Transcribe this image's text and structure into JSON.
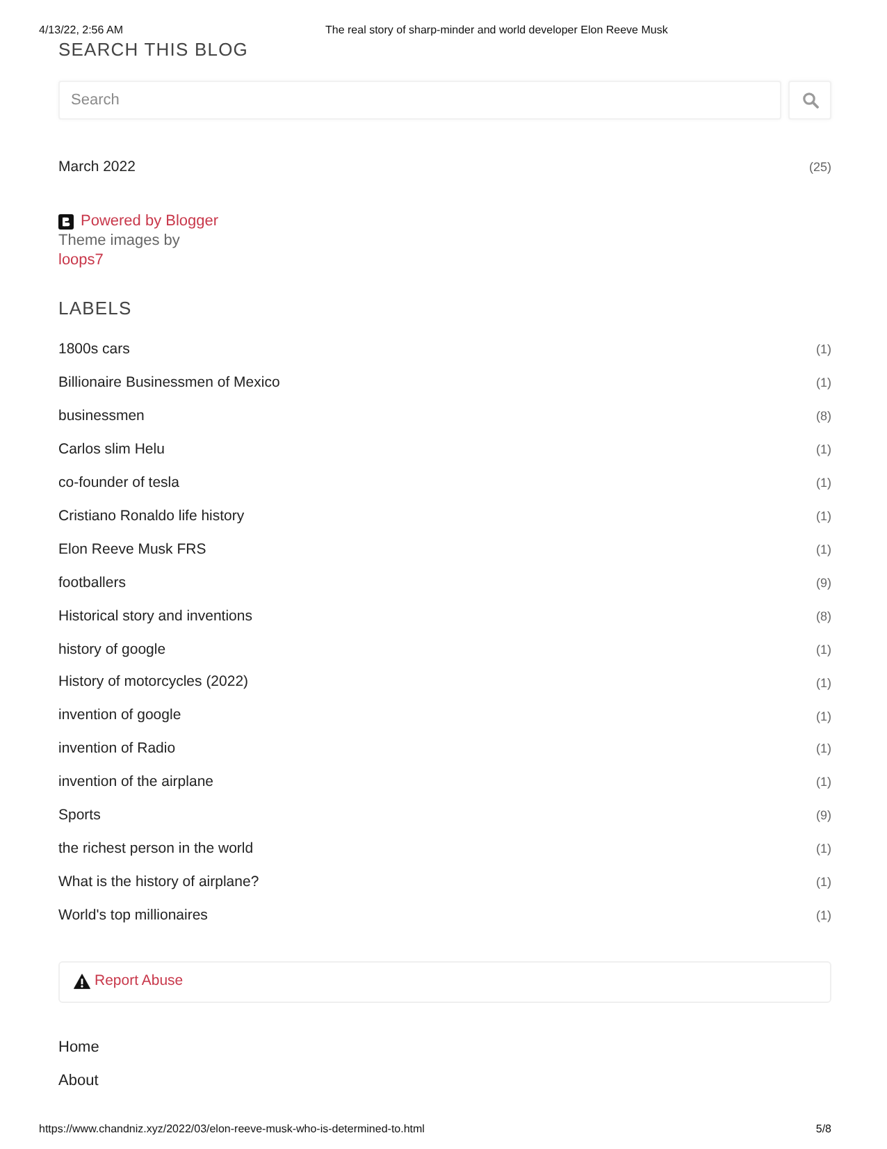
{
  "print_header": {
    "date": "4/13/22, 2:56 AM",
    "title": "The real story of sharp-minder and world developer Elon Reeve Musk"
  },
  "search_widget": {
    "heading": "SEARCH THIS BLOG",
    "placeholder": "Search"
  },
  "archive": [
    {
      "label": "March 2022",
      "count": "(25)"
    }
  ],
  "attribution": {
    "powered_by": "Powered by Blogger",
    "theme_text": "Theme images by",
    "theme_author": "loops7"
  },
  "labels": {
    "heading": "LABELS",
    "items": [
      {
        "label": "1800s cars",
        "count": "(1)"
      },
      {
        "label": "Billionaire Businessmen of Mexico",
        "count": "(1)"
      },
      {
        "label": "businessmen",
        "count": "(8)"
      },
      {
        "label": "Carlos slim Helu",
        "count": "(1)"
      },
      {
        "label": "co-founder of tesla",
        "count": "(1)"
      },
      {
        "label": "Cristiano Ronaldo life history",
        "count": "(1)"
      },
      {
        "label": "Elon Reeve Musk FRS",
        "count": "(1)"
      },
      {
        "label": "footballers",
        "count": "(9)"
      },
      {
        "label": "Historical story and inventions",
        "count": "(8)"
      },
      {
        "label": "history of google",
        "count": "(1)"
      },
      {
        "label": "History of motorcycles (2022)",
        "count": "(1)"
      },
      {
        "label": "invention of google",
        "count": "(1)"
      },
      {
        "label": "invention of Radio",
        "count": "(1)"
      },
      {
        "label": "invention of the airplane",
        "count": "(1)"
      },
      {
        "label": "Sports",
        "count": "(9)"
      },
      {
        "label": "the richest person in the world",
        "count": "(1)"
      },
      {
        "label": "What is the history of airplane?",
        "count": "(1)"
      },
      {
        "label": "World's top millionaires",
        "count": "(1)"
      }
    ]
  },
  "report_abuse": {
    "label": "Report Abuse"
  },
  "pages": [
    {
      "label": "Home"
    },
    {
      "label": "About"
    }
  ],
  "print_footer": {
    "url": "https://www.chandniz.xyz/2022/03/elon-reeve-musk-who-is-determined-to.html",
    "page": "5/8"
  }
}
